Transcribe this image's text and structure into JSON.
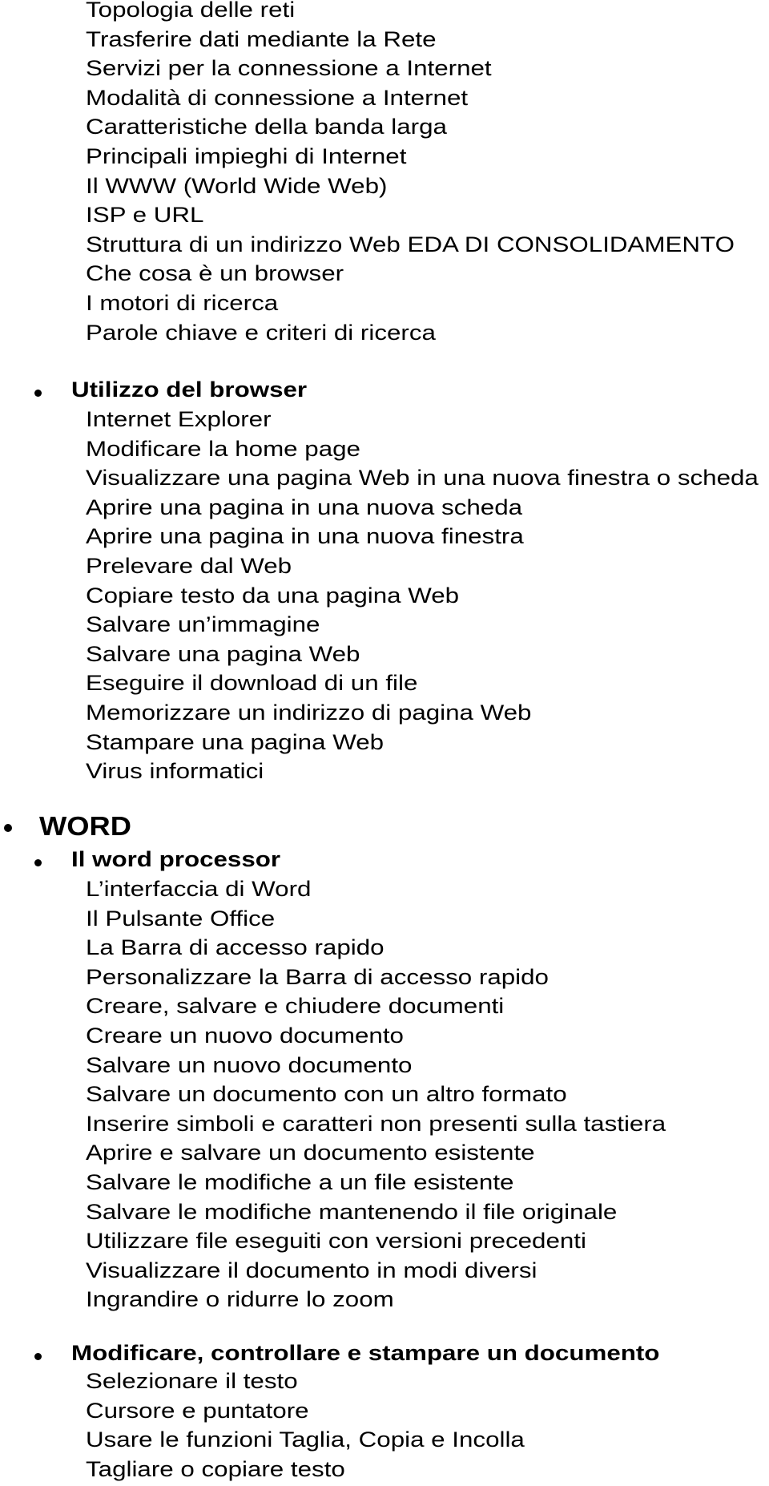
{
  "document": {
    "intro_items": [
      "Topologia delle reti",
      "Trasferire dati mediante la Rete",
      "Servizi per la connessione a Internet",
      "Modalità di connessione a Internet",
      "Caratteristiche della banda larga",
      "Principali impieghi di Internet",
      "Il WWW (World Wide Web)",
      "ISP e URL",
      "Struttura di un indirizzo Web EDA DI CONSOLIDAMENTO",
      "Che cosa è un browser",
      "I motori di ricerca",
      "Parole chiave e criteri di ricerca"
    ],
    "browser_section": {
      "heading": "Utilizzo del browser",
      "items": [
        "Internet Explorer",
        "Modificare la home page",
        "Visualizzare una pagina Web in una nuova finestra o scheda",
        "Aprire una pagina in una nuova scheda",
        "Aprire una pagina in una nuova finestra",
        "Prelevare dal Web",
        "Copiare testo da una pagina Web",
        "Salvare un’immagine",
        "Salvare una pagina Web",
        "Eseguire il download di un file",
        "Memorizzare un indirizzo di pagina Web",
        "Stampare una pagina Web",
        "Virus informatici"
      ]
    },
    "word_chapter": {
      "title": "WORD",
      "sections": [
        {
          "heading": "Il word processor",
          "items": [
            "L’interfaccia di Word",
            "Il Pulsante Office",
            "La Barra di accesso rapido",
            "Personalizzare la Barra di accesso rapido",
            "Creare, salvare e chiudere documenti",
            "Creare un nuovo documento",
            "Salvare un nuovo documento",
            "Salvare un documento con un altro formato",
            "Inserire simboli e caratteri non presenti sulla tastiera",
            "Aprire e salvare un documento esistente",
            "Salvare le modifiche a un file esistente",
            "Salvare le modifiche mantenendo il file originale",
            "Utilizzare file eseguiti con versioni precedenti",
            "Visualizzare il documento in modi diversi",
            "Ingrandire o ridurre lo zoom"
          ]
        },
        {
          "heading": "Modificare, controllare e stampare un documento",
          "items": [
            "Selezionare il testo",
            "Cursore e puntatore",
            "Usare le funzioni Taglia, Copia e Incolla",
            "Tagliare o copiare testo"
          ]
        }
      ]
    }
  }
}
